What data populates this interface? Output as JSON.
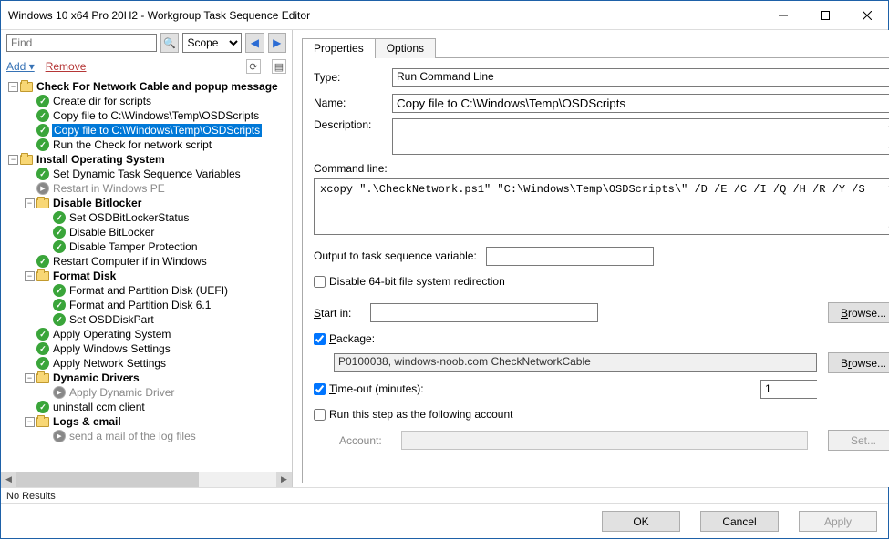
{
  "window_title": "Windows 10 x64 Pro 20H2 - Workgroup Task Sequence Editor",
  "toolbar": {
    "find_placeholder": "Find",
    "scope_label": "Scope",
    "add": "Add",
    "remove": "Remove",
    "no_results": "No Results"
  },
  "tree": [
    {
      "depth": 0,
      "exp": "-",
      "icon": "folder",
      "label": "Check For Network Cable and popup message",
      "bold": true
    },
    {
      "depth": 1,
      "icon": "ok",
      "label": "Create dir for scripts"
    },
    {
      "depth": 1,
      "icon": "ok",
      "label": "Copy file to C:\\Windows\\Temp\\OSDScripts"
    },
    {
      "depth": 1,
      "icon": "ok",
      "label": "Copy file to C:\\Windows\\Temp\\OSDScripts",
      "selected": true
    },
    {
      "depth": 1,
      "icon": "ok",
      "label": "Run the Check for network script"
    },
    {
      "depth": 0,
      "exp": "-",
      "icon": "folder",
      "label": "Install Operating System",
      "bold": true
    },
    {
      "depth": 1,
      "icon": "ok",
      "label": "Set Dynamic Task Sequence Variables"
    },
    {
      "depth": 1,
      "icon": "arrow",
      "label": "Restart in Windows PE",
      "dim": true
    },
    {
      "depth": 1,
      "exp": "-",
      "icon": "folder",
      "label": "Disable Bitlocker",
      "bold": true
    },
    {
      "depth": 2,
      "icon": "ok",
      "label": "Set OSDBitLockerStatus"
    },
    {
      "depth": 2,
      "icon": "ok",
      "label": "Disable BitLocker"
    },
    {
      "depth": 2,
      "icon": "ok",
      "label": "Disable Tamper Protection"
    },
    {
      "depth": 1,
      "icon": "ok",
      "label": "Restart Computer if in Windows"
    },
    {
      "depth": 1,
      "exp": "-",
      "icon": "folder",
      "label": "Format Disk",
      "bold": true
    },
    {
      "depth": 2,
      "icon": "ok",
      "label": "Format and Partition Disk (UEFI)"
    },
    {
      "depth": 2,
      "icon": "ok",
      "label": "Format and Partition Disk 6.1"
    },
    {
      "depth": 2,
      "icon": "ok",
      "label": "Set OSDDiskPart"
    },
    {
      "depth": 1,
      "icon": "ok",
      "label": "Apply Operating System"
    },
    {
      "depth": 1,
      "icon": "ok",
      "label": "Apply Windows Settings"
    },
    {
      "depth": 1,
      "icon": "ok",
      "label": "Apply Network Settings"
    },
    {
      "depth": 1,
      "exp": "-",
      "icon": "folder",
      "label": "Dynamic Drivers",
      "bold": true
    },
    {
      "depth": 2,
      "icon": "arrow",
      "label": "Apply Dynamic Driver",
      "dim": true
    },
    {
      "depth": 1,
      "icon": "ok",
      "label": "uninstall ccm client"
    },
    {
      "depth": 1,
      "exp": "-",
      "icon": "folder",
      "label": "Logs & email",
      "bold": true
    },
    {
      "depth": 2,
      "icon": "arrow",
      "label": "send a mail of the log files",
      "dim": true
    }
  ],
  "tabs": {
    "properties": "Properties",
    "options": "Options"
  },
  "props": {
    "type_lbl": "Type:",
    "type_val": "Run Command Line",
    "name_lbl": "Name:",
    "name_val": "Copy file to C:\\Windows\\Temp\\OSDScripts",
    "desc_lbl": "Description:",
    "cmd_lbl": "Command line:",
    "cmd_val": "xcopy \".\\CheckNetwork.ps1\" \"C:\\Windows\\Temp\\OSDScripts\\\" /D /E /C /I /Q /H /R /Y /S",
    "outvar_lbl": "Output to task sequence variable:",
    "disable64": "Disable 64-bit file system redirection",
    "startin": "Start in:",
    "browse": "Browse...",
    "package": "Package:",
    "package_val": "P0100038, windows-noob.com CheckNetworkCable",
    "timeout": "Time-out (minutes):",
    "timeout_val": "1",
    "runas": "Run this step as the following account",
    "account": "Account:",
    "set": "Set..."
  },
  "footer": {
    "ok": "OK",
    "cancel": "Cancel",
    "apply": "Apply"
  }
}
